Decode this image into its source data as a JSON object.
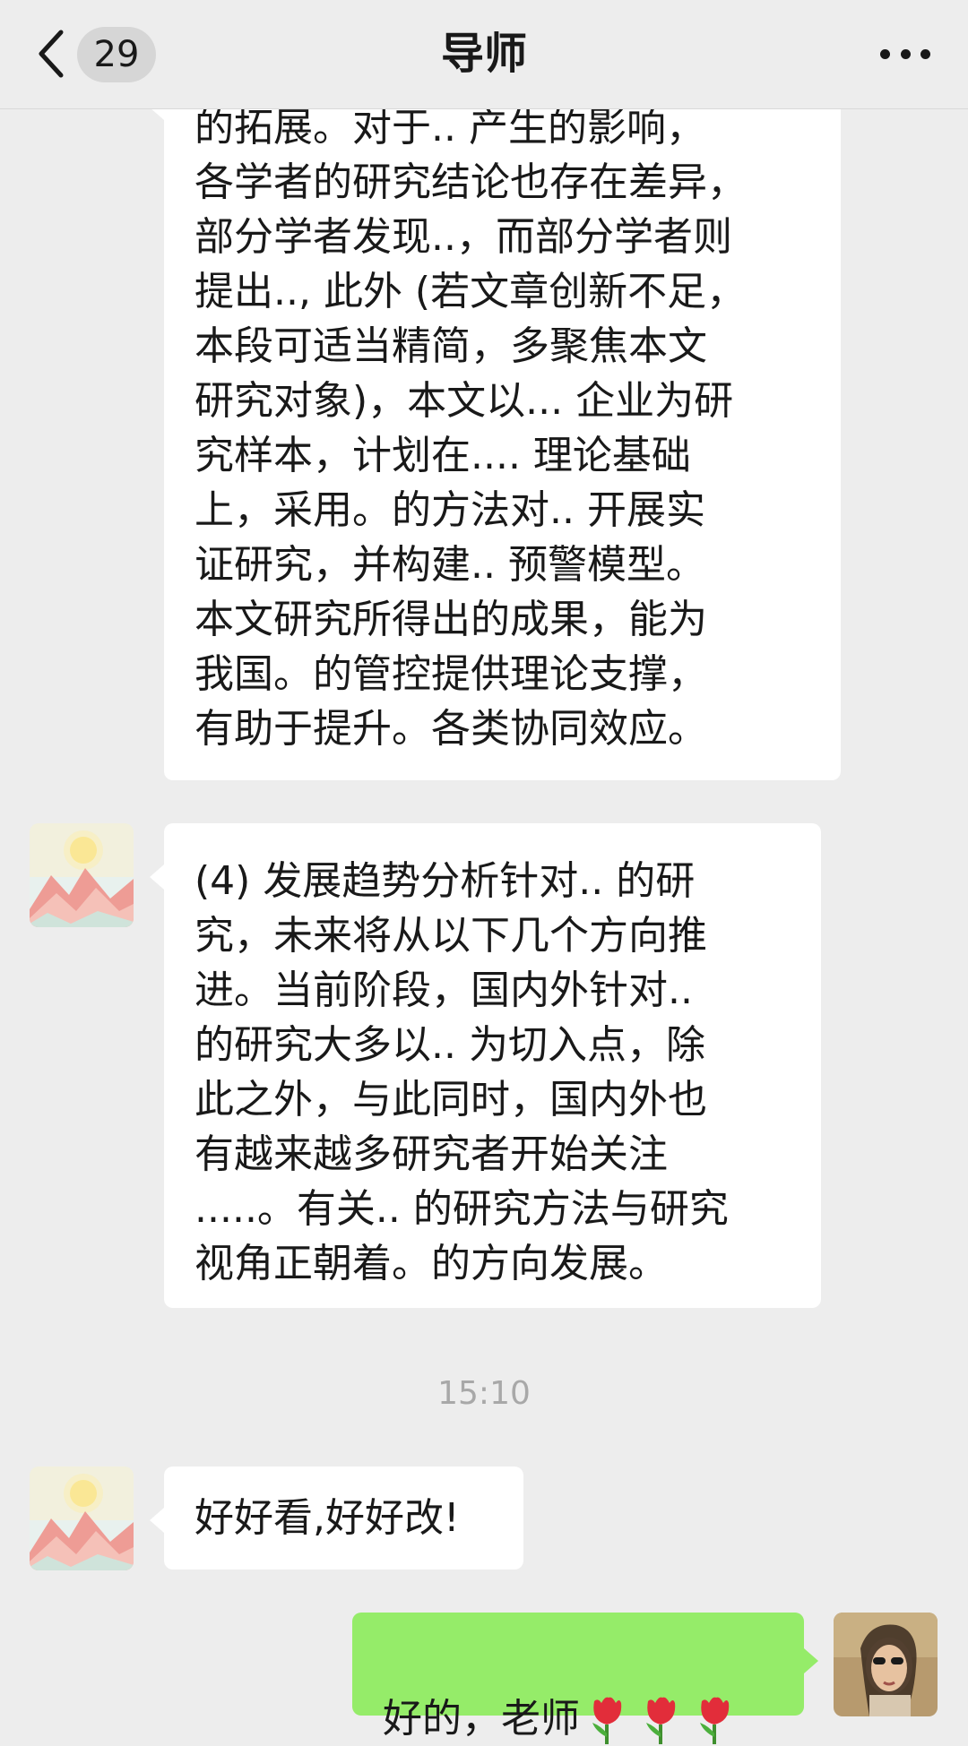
{
  "header": {
    "unread_count": "29",
    "title": "导师",
    "back_icon": "chevron-left-icon",
    "more_icon": "more-dots-icon"
  },
  "messages": [
    {
      "side": "left",
      "text": "的拓展。对于.. 产生的影响，\n各学者的研究结论也存在差异，\n部分学者发现..，而部分学者则\n提出.., 此外 (若文章创新不足，\n本段可适当精简，多聚焦本文\n研究对象)，本文以... 企业为研\n究样本，计划在.... 理论基础\n上，采用。的方法对.. 开展实\n证研究，并构建.. 预警模型。\n本文研究所得出的成果，能为\n我国。的管控提供理论支撑，\n有助于提升。各类协同效应。"
    },
    {
      "side": "left",
      "text": "(4) 发展趋势分析针对.. 的研\n究，未来将从以下几个方向推\n进。当前阶段，国内外针对..\n的研究大多以.. 为切入点，除\n此之外，与此同时，国内外也\n有越来越多研究者开始关注\n.....。有关.. 的研究方法与研究\n视角正朝着。的方向发展。"
    },
    {
      "side": "left",
      "text": "好好看,好好改!"
    },
    {
      "side": "right",
      "text": "好的，老师",
      "emoji": "tulip-icon",
      "emoji_count": 3
    }
  ],
  "timestamp": "15:10",
  "colors": {
    "background": "#ededed",
    "incoming_bubble": "#ffffff",
    "outgoing_bubble": "#95ec69",
    "timestamp": "#a8a8a8"
  }
}
